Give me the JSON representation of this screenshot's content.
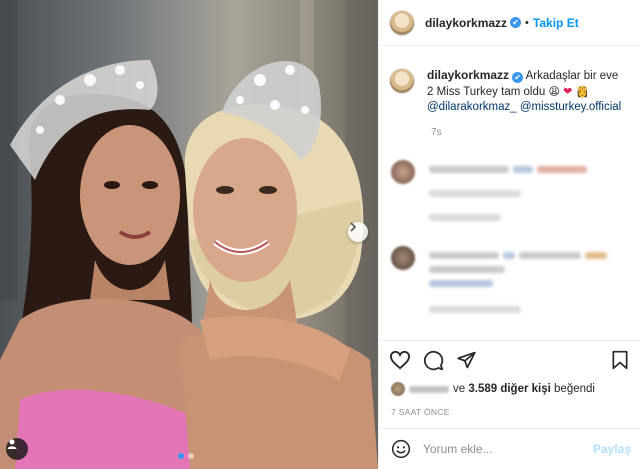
{
  "header": {
    "username": "dilaykorkmazz",
    "verified_glyph": "✔",
    "separator": "•",
    "follow_label": "Takip Et"
  },
  "caption": {
    "username": "dilaykorkmazz",
    "text": "Arkadaşlar bir eve 2 Miss Turkey tam oldu",
    "emojis": [
      "😩",
      "❤",
      "👸"
    ],
    "mentions": [
      "@dilarakorkmaz_",
      "@missturkey.official"
    ],
    "time": "7s"
  },
  "actions": {
    "icons": [
      "heart-icon",
      "comment-icon",
      "share-icon",
      "bookmark-icon"
    ],
    "likes_prefix": "ve",
    "likes_count": "3.589 diğer kişi",
    "likes_suffix": "beğendi",
    "posted_ago": "7 SAAT ÖNCE"
  },
  "comment_box": {
    "placeholder": "Yorum ekle...",
    "post_label": "Paylaş"
  },
  "photo": {
    "carousel_index": 1,
    "carousel_total": 2,
    "accent": "#3897f0"
  }
}
